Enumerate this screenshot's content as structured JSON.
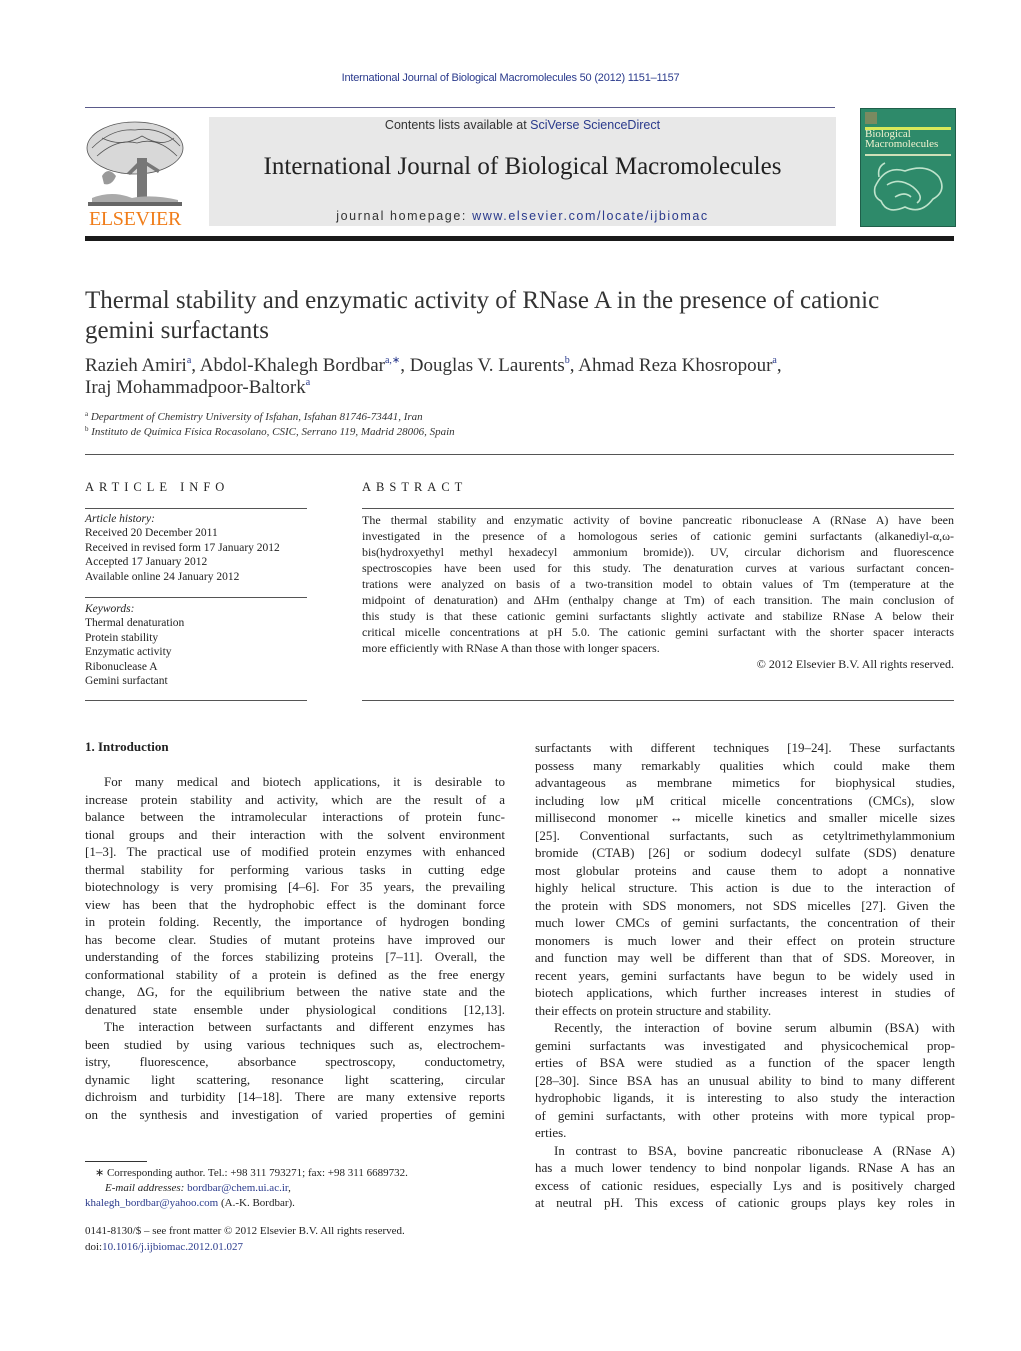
{
  "header": {
    "running_head": "International Journal of Biological Macromolecules 50 (2012) 1151–1157",
    "publisher_logo_text": "ELSEVIER",
    "contents_prefix": "Contents lists available at ",
    "contents_link": "SciVerse ScienceDirect",
    "journal_title": "International Journal of Biological Macromolecules",
    "homepage_prefix": "journal homepage: ",
    "homepage_link": "www.elsevier.com/locate/ijbiomac",
    "cover_title_line1": "Biological",
    "cover_title_line2": "Macromolecules"
  },
  "article": {
    "title_line1": "Thermal stability and enzymatic activity of RNase A in the presence of cationic",
    "title_line2": "gemini surfactants",
    "authors": [
      {
        "name": "Razieh Amiri",
        "sup": "a",
        "sep": ", "
      },
      {
        "name": "Abdol-Khalegh Bordbar",
        "sup": "a,∗",
        "sep": ", "
      },
      {
        "name": "Douglas V. Laurents",
        "sup": "b",
        "sep": ", "
      },
      {
        "name": "Ahmad Reza Khosropour",
        "sup": "a",
        "sep": ","
      },
      {
        "name": "Iraj Mohammadpoor-Baltork",
        "sup": "a",
        "sep": ""
      }
    ],
    "affiliations": [
      {
        "label": "a",
        "text": "Department of Chemistry University of Isfahan, Isfahan 81746-73441, Iran"
      },
      {
        "label": "b",
        "text": "Instituto de Química Física Rocasolano, CSIC, Serrano 119, Madrid 28006, Spain"
      }
    ]
  },
  "article_info": {
    "heading": "ARTICLE INFO",
    "history_label": "Article history:",
    "history": [
      "Received 20 December 2011",
      "Received in revised form 17 January 2012",
      "Accepted 17 January 2012",
      "Available online 24 January 2012"
    ],
    "keywords_label": "Keywords:",
    "keywords": [
      "Thermal denaturation",
      "Protein stability",
      "Enzymatic activity",
      "Ribonuclease A",
      "Gemini surfactant"
    ]
  },
  "abstract": {
    "heading": "ABSTRACT",
    "lines": [
      "The thermal stability and enzymatic activity of bovine pancreatic ribonuclease A (RNase A) have been",
      "investigated in the presence of a homologous series of cationic gemini surfactants (alkanediyl-α,ω-",
      "bis(hydroxyethyl methyl hexadecyl ammonium bromide)). UV, circular dichorism and fluorescence",
      "spectroscopies have been used for this study. The denaturation curves at various surfactant concen-",
      "trations were analyzed on basis of a two-transition model to obtain values of Tm (temperature at the",
      "midpoint of denaturation) and ΔHm (enthalpy change at Tm) of each transition. The main conclusion of",
      "this study is that these cationic gemini surfactants slightly activate and stabilize RNase A below their",
      "critical micelle concentrations at pH 5.0. The cationic gemini surfactant with the shorter spacer interacts",
      "more efficiently with RNase A than those with longer spacers."
    ],
    "copyright": "© 2012 Elsevier B.V. All rights reserved."
  },
  "introduction": {
    "heading": "1.  Introduction",
    "left_lines": [
      "For many medical and biotech applications, it is desirable to",
      "increase protein stability and activity, which are the result of a",
      "balance between the intramolecular interactions of protein func-",
      "tional groups and their interaction with the solvent environment",
      "[1–3]. The practical use of modified protein enzymes with enhanced",
      "thermal stability for performing various tasks in cutting edge",
      "biotechnology is very promising [4–6]. For 35 years, the prevailing",
      "view has been that the hydrophobic effect is the dominant force",
      "in protein folding. Recently, the importance of hydrogen bonding",
      "has become clear. Studies of mutant proteins have improved our",
      "understanding of the forces stabilizing proteins [7–11]. Overall, the",
      "conformational stability of a protein is defined as the free energy",
      "change, ΔG, for the equilibrium between the native state and the",
      "denatured state ensemble under physiological conditions [12,13].",
      "The interaction between surfactants and different enzymes has",
      "been studied by using various techniques such as, electrochem-",
      "istry, fluorescence, absorbance spectroscopy, conductometry,",
      "dynamic light scattering, resonance light scattering, circular",
      "dichroism and turbidity [14–18]. There are many extensive reports",
      "on the synthesis and investigation of varied properties of gemini"
    ],
    "right_lines": [
      "surfactants with different techniques [19–24]. These surfactants",
      "possess many remarkably qualities which could make them",
      "advantageous as membrane mimetics for biophysical studies,",
      "including low μM critical micelle concentrations (CMCs), slow",
      "millisecond monomer ↔ micelle kinetics and smaller micelle sizes",
      "[25]. Conventional surfactants, such as cetyltrimethylammonium",
      "bromide (CTAB) [26] or sodium dodecyl sulfate (SDS) denature",
      "most globular proteins and cause them to adopt a nonnative",
      "highly helical structure. This action is due to the interaction of",
      "the protein with SDS monomers, not SDS micelles [27]. Given the",
      "much lower CMCs of gemini surfactants, the concentration of their",
      "monomers is much lower and their effect on protein structure",
      "and function may well be different than that of SDS. Moreover, in",
      "recent years, gemini surfactants have begun to be widely used in",
      "biotech applications, which further increases interest in studies of",
      "their effects on protein structure and stability.",
      "Recently, the interaction of bovine serum albumin (BSA) with",
      "gemini surfactants was investigated and physicochemical prop-",
      "erties of BSA were studied as a function of the spacer length",
      "[28–30]. Since BSA has an unusual ability to bind to many different",
      "hydrophobic ligands, it is interesting to also study the interaction",
      "of gemini surfactants, with other proteins with more typical prop-",
      "erties.",
      "In contrast to BSA, bovine pancreatic ribonuclease A (RNase A)",
      "has a much lower tendency to bind nonpolar ligands. RNase A has an",
      "excess of cationic residues, especially Lys and is positively charged",
      "at neutral pH. This excess of cationic groups plays key roles in"
    ]
  },
  "footnotes": {
    "corresponding": "∗ Corresponding author. Tel.: +98 311 793271; fax: +98 311 6689732.",
    "email_label": "E-mail addresses: ",
    "email1": "bordbar@chem.ui.ac.ir",
    "email2": "khalegh_bordbar@yahoo.com",
    "email2_suffix": " (A.-K. Bordbar).",
    "front_matter": "0141-8130/$ – see front matter © 2012 Elsevier B.V. All rights reserved.",
    "doi_prefix": "doi:",
    "doi": "10.1016/j.ijbiomac.2012.01.027"
  },
  "colors": {
    "link": "#2a3a8c",
    "elsevier_orange": "#f07d1a",
    "cover_green": "#2e8a6a",
    "banner_gray": "#e8e8e8"
  }
}
